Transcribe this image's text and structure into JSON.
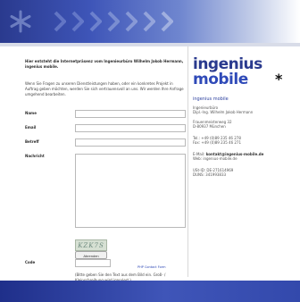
{
  "intro": {
    "bold": "Hier entsteht die Internetpräsenz vom Ingenieurbüro Wilhelm Jakob Hermann, ingenius mobile.",
    "text": "Wenn Sie Fragen zu unseren Dienstleistungen haben, oder ein konkretes Projekt in Auftrag geben möchten, werden Sie sich vertrauensvoll an uns. Wir werden Ihre Anfrage umgehend bearbeiten."
  },
  "form": {
    "name_label": "Name",
    "email_label": "Email",
    "subject_label": "Betreff",
    "message_label": "Nachricht",
    "captcha_text": "KZK7S",
    "code_label": "Code",
    "help_text": "(Bitte geben Sie den Text aus dem Bild ein. Groß- / Kleinschreibung wird ignoriert.)",
    "reload_link": "Klicken Sie hier um das Bild neu zu laden.",
    "submit_label": "Abrenden",
    "php_link": "PHP Contact Form"
  },
  "company": {
    "logo_line1": "ingenius",
    "logo_line2": "mobile",
    "logo_asterisk": "*",
    "name": "ingenius mobile",
    "office": "Ingenieurbüro",
    "engineer": "Dipl.-Ing. Wilhelm Jakob Hermann",
    "street": "Frauenmeisterweg 32",
    "city": "D-80937 München",
    "phone": "Tel.: +49 (0)89 235 46 278",
    "fax": "Fax: +49 (0)89 235 46 271",
    "email_label": "E-Mail:",
    "email": "kontakt@ingenius-mobile.de",
    "web_label": "Web:",
    "web": "ingenius-mobile.de",
    "ust": "USt-ID: DE-271614969",
    "duns": "DUNS: 341993833"
  },
  "colors": {
    "brand_dark": "#2a3a8e",
    "brand_blue": "#2f4ab8",
    "link": "#2b46b5"
  }
}
